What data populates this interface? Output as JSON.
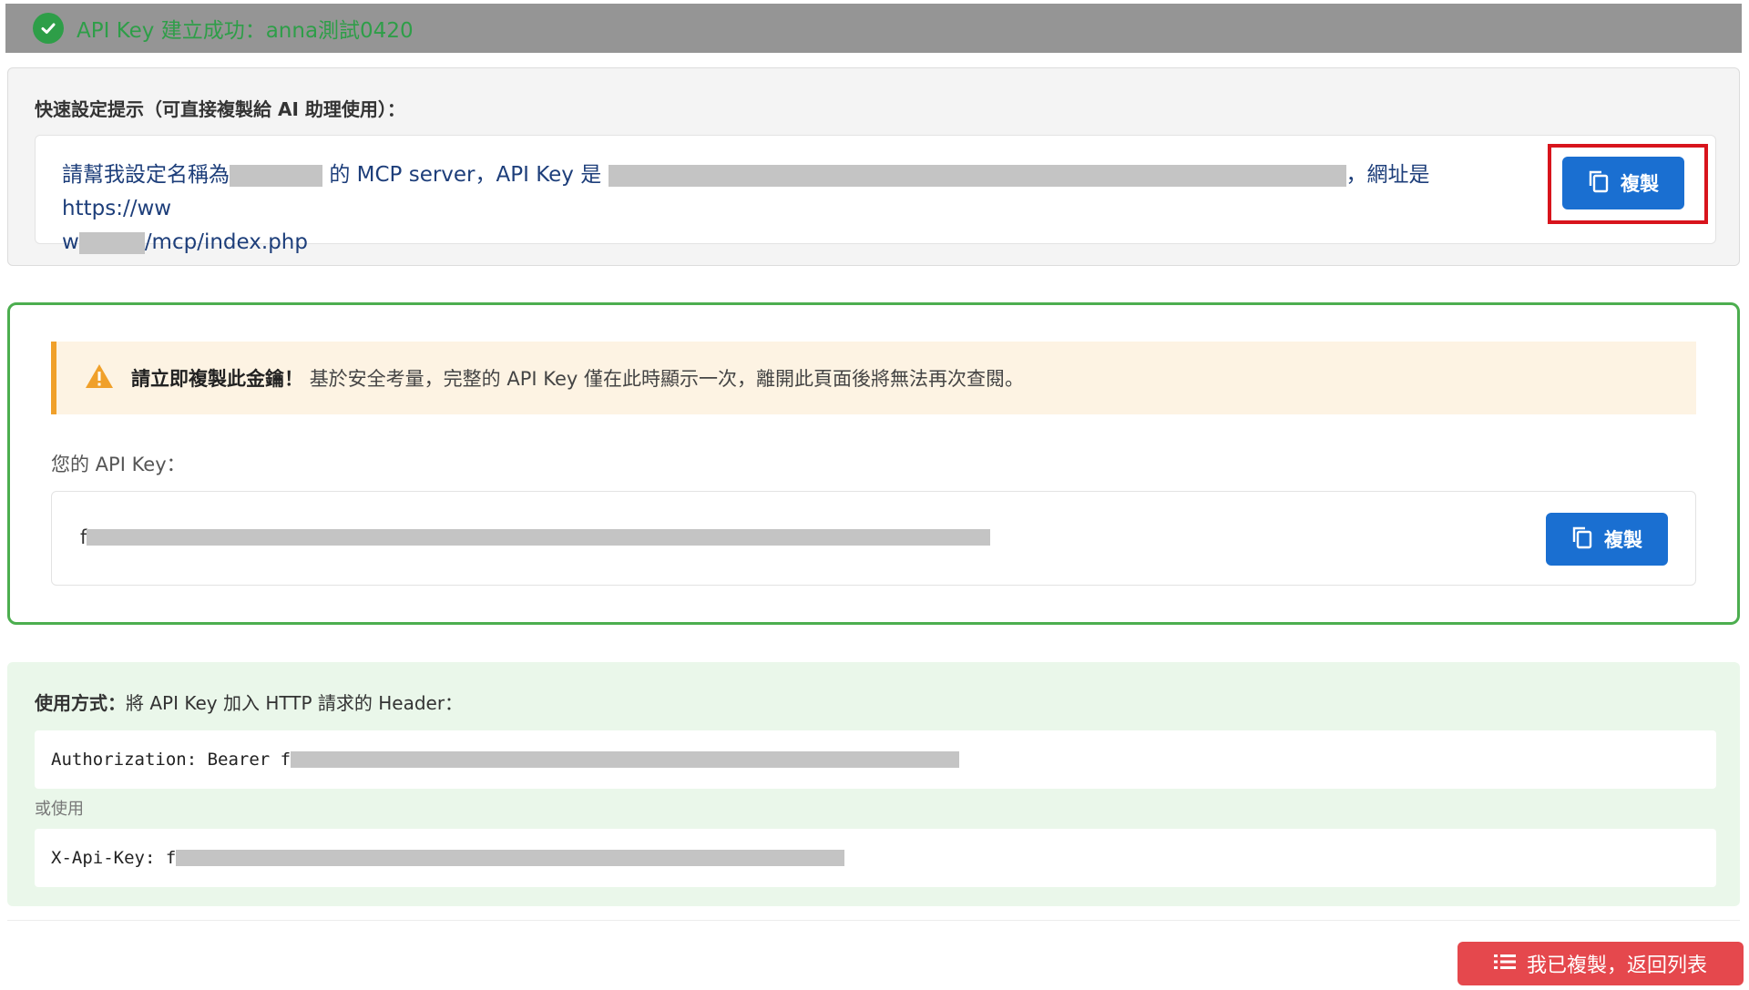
{
  "banner": {
    "text": "API Key 建立成功：anna測試0420",
    "icon": "check-circle-icon",
    "color": "#2e9e48"
  },
  "quick_setup": {
    "title": "快速設定提示（可直接複製給 AI 助理使用）：",
    "prompt_part1": "請幫我設定名稱為",
    "prompt_part2": "的 MCP server，API Key 是",
    "prompt_part3": "，網址是 https://ww",
    "prompt_part4": "w",
    "prompt_part5": "/mcp/index.php",
    "copy_label": "複製"
  },
  "api_key_section": {
    "warning_strong": "請立即複製此金鑰！",
    "warning_text": "基於安全考量，完整的 API Key 僅在此時顯示一次，離開此頁面後將無法再次查閱。",
    "label": "您的 API Key：",
    "key_prefix": "f",
    "copy_label": "複製"
  },
  "usage": {
    "title_strong": "使用方式：",
    "title_text": "將 API Key 加入 HTTP 請求的 Header：",
    "header1_prefix": "Authorization: Bearer f",
    "or_text": "或使用",
    "header2_prefix": "X-Api-Key: f"
  },
  "footer": {
    "back_label": "我已複製，返回列表",
    "back_icon": "list-icon"
  },
  "colors": {
    "primary": "#1a6fd1",
    "success": "#4cae4f",
    "warning": "#f0a02a",
    "danger": "#e5484d",
    "highlight": "#d8141c"
  }
}
